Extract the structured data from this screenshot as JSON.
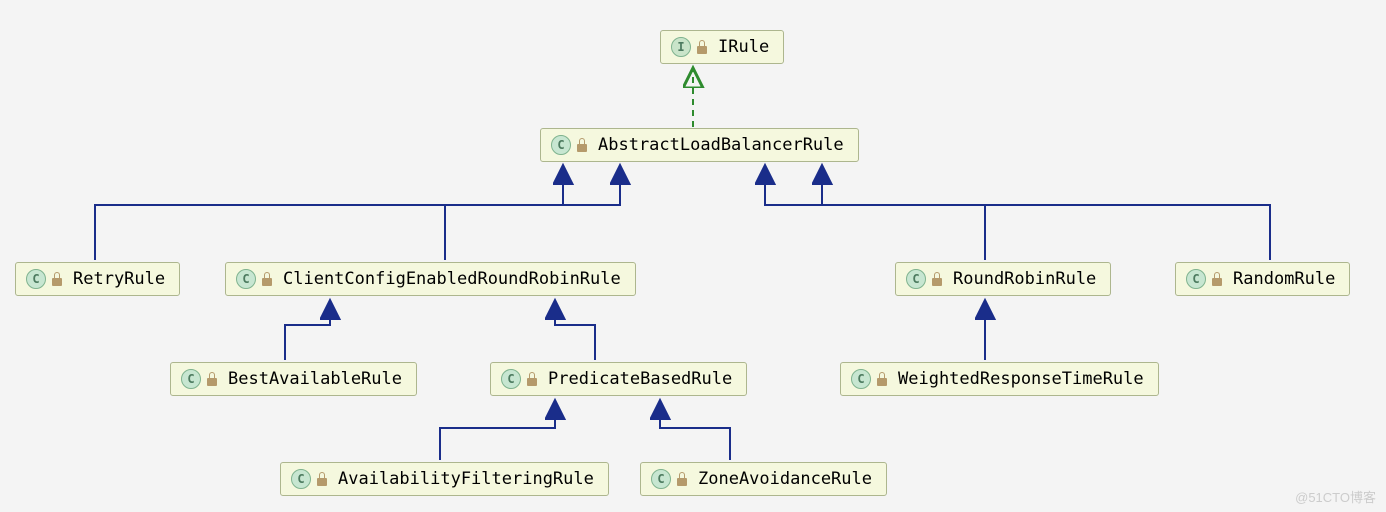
{
  "diagram": {
    "nodes": {
      "irule": {
        "label": "IRule",
        "type": "I"
      },
      "abstract": {
        "label": "AbstractLoadBalancerRule",
        "type": "C"
      },
      "retry": {
        "label": "RetryRule",
        "type": "C"
      },
      "ccerrr": {
        "label": "ClientConfigEnabledRoundRobinRule",
        "type": "C"
      },
      "rr": {
        "label": "RoundRobinRule",
        "type": "C"
      },
      "random": {
        "label": "RandomRule",
        "type": "C"
      },
      "best": {
        "label": "BestAvailableRule",
        "type": "C"
      },
      "pred": {
        "label": "PredicateBasedRule",
        "type": "C"
      },
      "wrt": {
        "label": "WeightedResponseTimeRule",
        "type": "C"
      },
      "afr": {
        "label": "AvailabilityFilteringRule",
        "type": "C"
      },
      "zar": {
        "label": "ZoneAvoidanceRule",
        "type": "C"
      }
    },
    "edges": [
      {
        "from": "abstract",
        "to": "irule",
        "style": "implements"
      },
      {
        "from": "retry",
        "to": "abstract",
        "style": "extends"
      },
      {
        "from": "ccerrr",
        "to": "abstract",
        "style": "extends"
      },
      {
        "from": "rr",
        "to": "abstract",
        "style": "extends"
      },
      {
        "from": "random",
        "to": "abstract",
        "style": "extends"
      },
      {
        "from": "best",
        "to": "ccerrr",
        "style": "extends"
      },
      {
        "from": "pred",
        "to": "ccerrr",
        "style": "extends"
      },
      {
        "from": "wrt",
        "to": "rr",
        "style": "extends"
      },
      {
        "from": "afr",
        "to": "pred",
        "style": "extends"
      },
      {
        "from": "zar",
        "to": "pred",
        "style": "extends"
      }
    ]
  },
  "watermark": "@51CTO博客"
}
